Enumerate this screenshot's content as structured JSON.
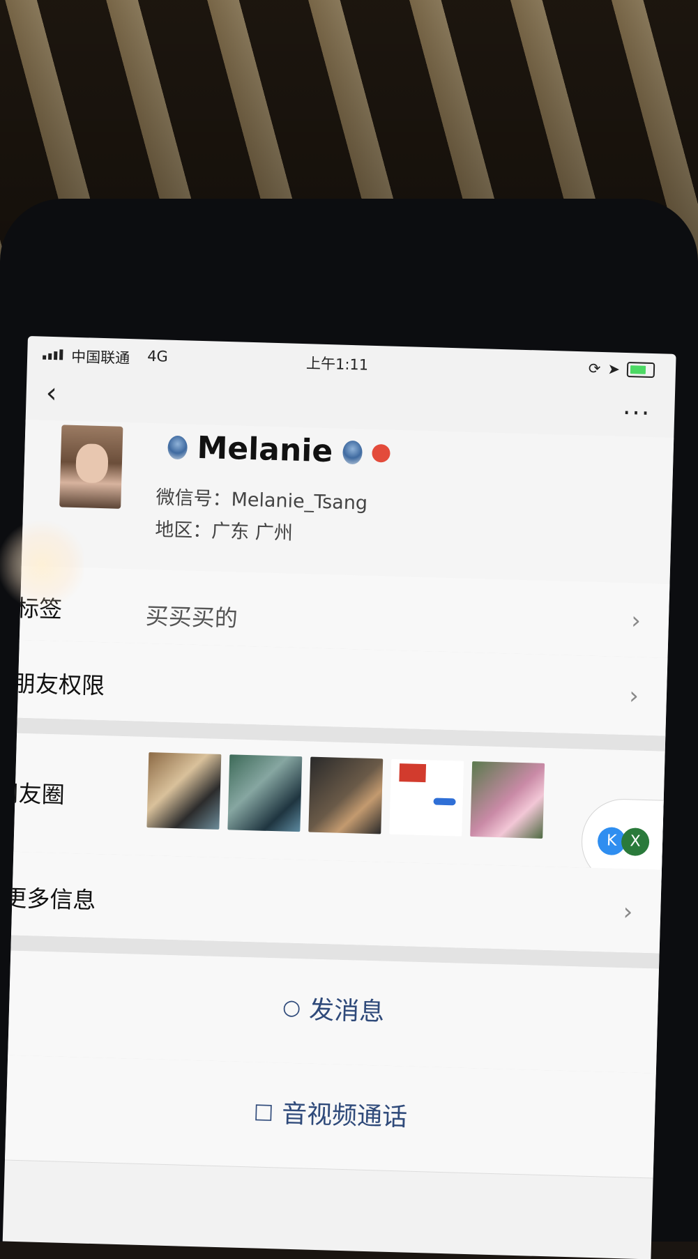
{
  "status_bar": {
    "carrier": "中国联通",
    "network": "4G",
    "time": "上午1:11"
  },
  "header": {
    "back_icon": "chevron-left-icon",
    "more_label": "..."
  },
  "profile": {
    "name": "Melanie",
    "wechat_id": "微信号：Melanie_Tsang",
    "region": "地区：广东 广州",
    "badge_icons": [
      "pin-icon",
      "pin-icon",
      "person-badge-icon"
    ]
  },
  "rows": {
    "tags_label": "标签",
    "tags_value": "买买买的",
    "permissions_label": "朋友权限",
    "moments_label": "朋友圈",
    "more_info_label": "更多信息"
  },
  "moments": {
    "thumb_count_visible": 5
  },
  "floating_buttons": {
    "left_label": "K",
    "right_label": "X"
  },
  "actions": {
    "message_label": "发消息",
    "call_label": "音视频通话"
  }
}
